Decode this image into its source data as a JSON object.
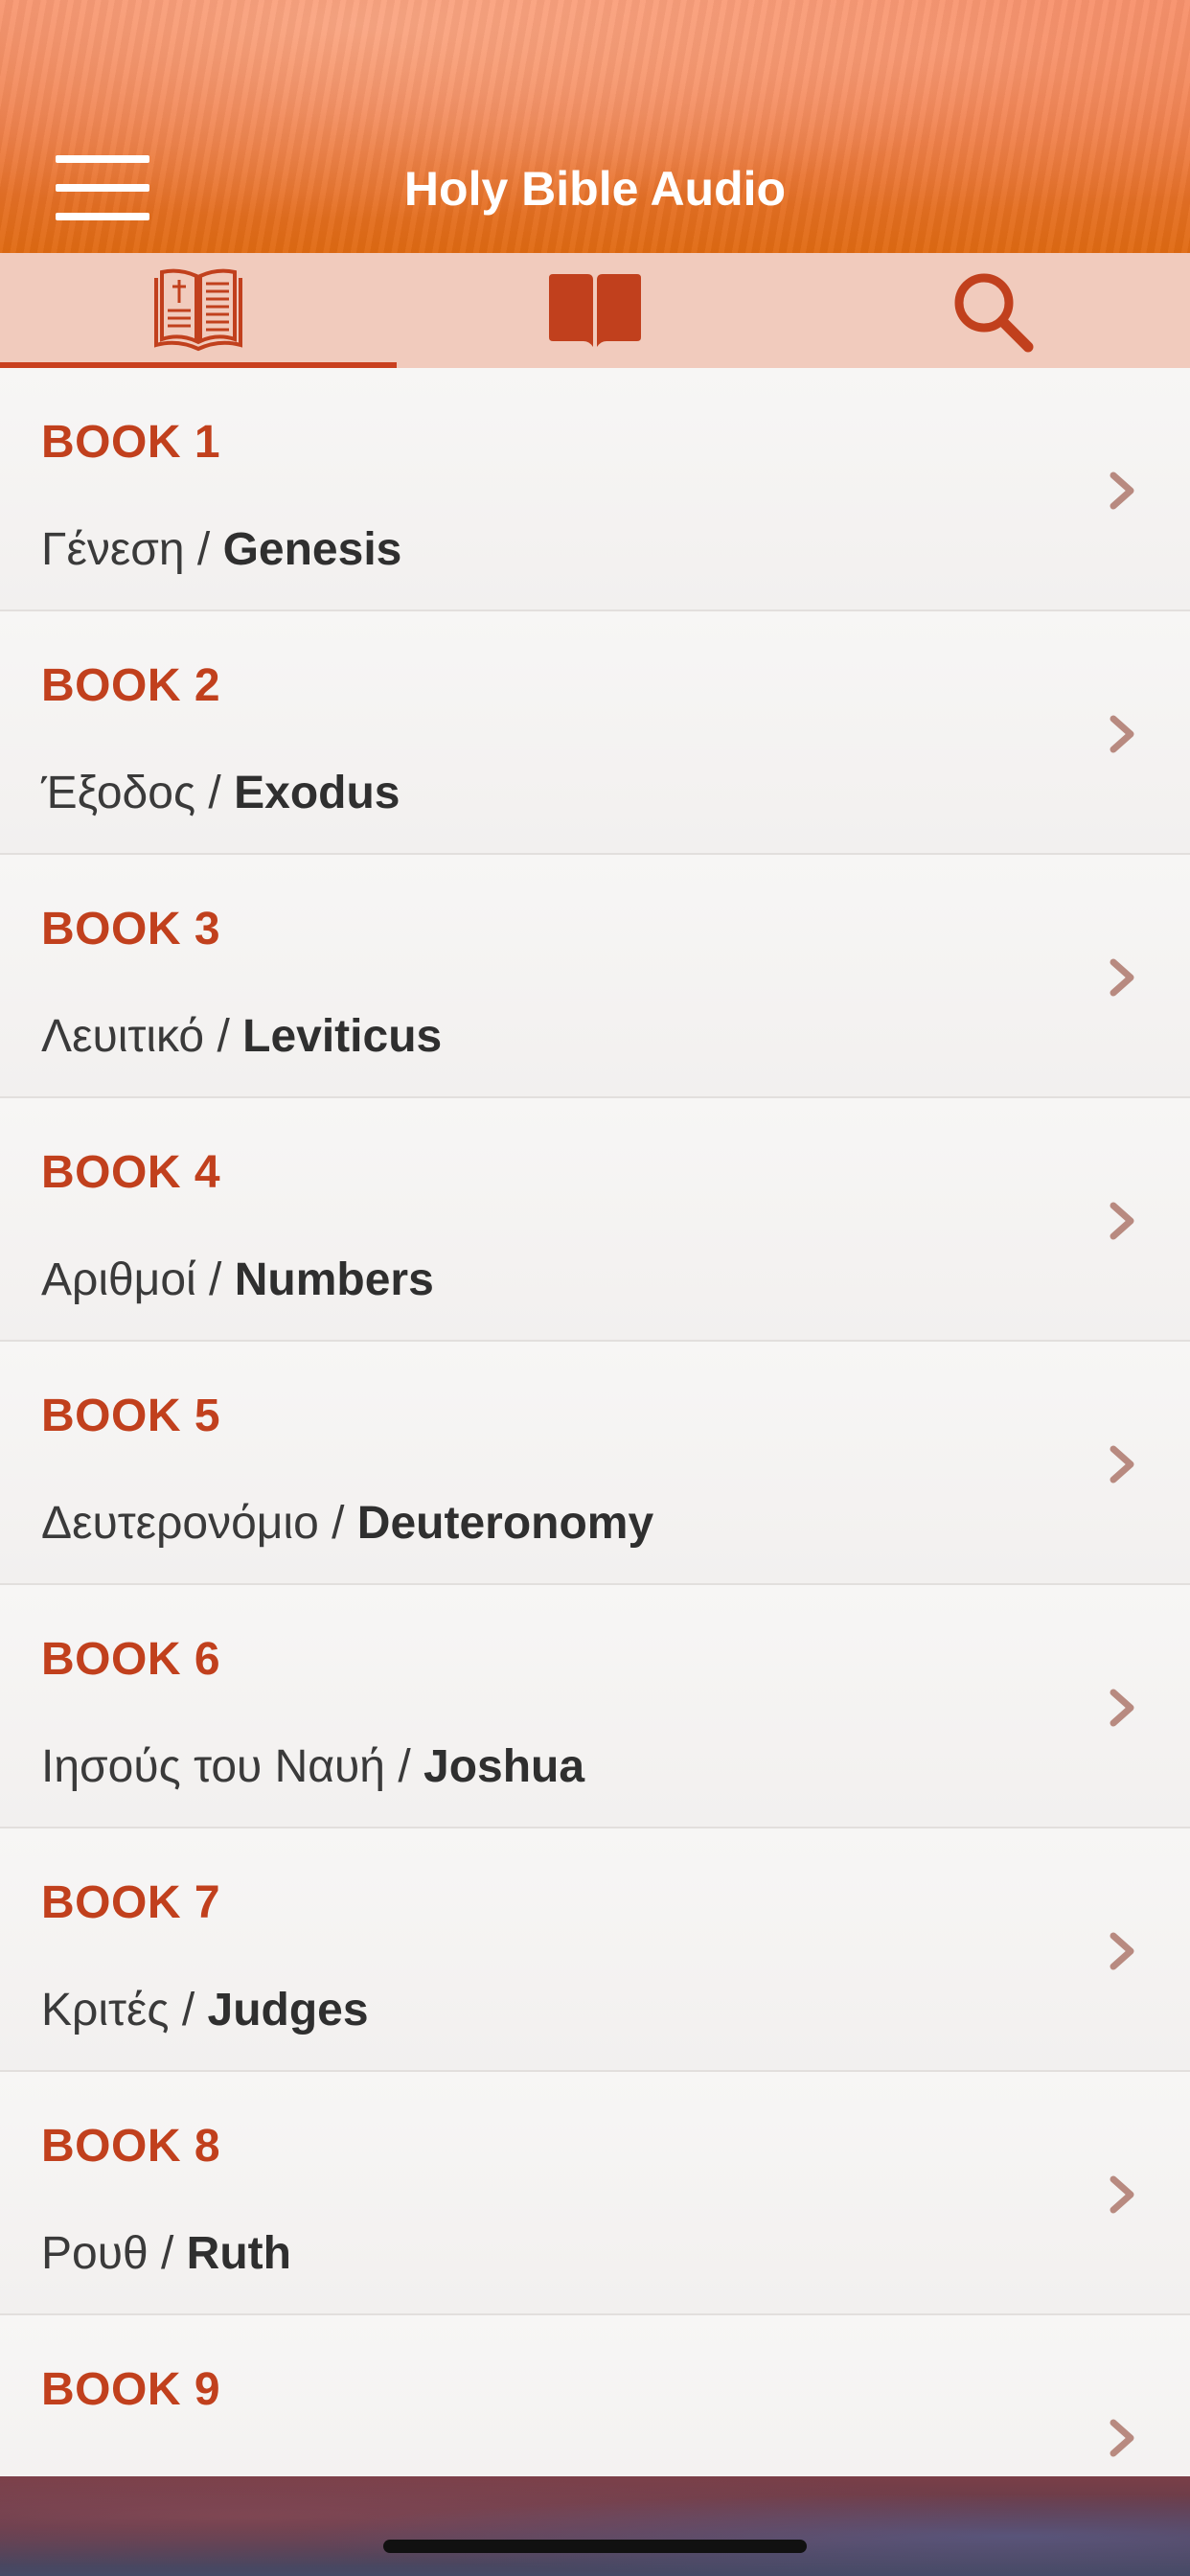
{
  "header": {
    "title": "Holy Bible Audio",
    "menu_icon": "hamburger-menu-icon",
    "background_color": "#e06a12"
  },
  "tabs": [
    {
      "icon": "bible-book-icon",
      "active": true
    },
    {
      "icon": "open-book-icon",
      "active": false
    },
    {
      "icon": "search-icon",
      "active": false
    }
  ],
  "colors": {
    "accent": "#c1401d",
    "tabbar": "#f1cbbd",
    "chevron": "#b88a80"
  },
  "books": [
    {
      "label": "BOOK 1",
      "greek": "Γένεση",
      "sep": " / ",
      "english": "Genesis"
    },
    {
      "label": "BOOK 2",
      "greek": "Έξοδος",
      "sep": " / ",
      "english": "Exodus"
    },
    {
      "label": "BOOK 3",
      "greek": "Λευιτικό",
      "sep": " / ",
      "english": "Leviticus"
    },
    {
      "label": "BOOK 4",
      "greek": "Αριθμοί",
      "sep": " / ",
      "english": "Numbers"
    },
    {
      "label": "BOOK 5",
      "greek": "Δευτερονόμιο",
      "sep": " / ",
      "english": "Deuteronomy"
    },
    {
      "label": "BOOK 6",
      "greek": "Ιησούς του Ναυή",
      "sep": " / ",
      "english": "Joshua"
    },
    {
      "label": "BOOK 7",
      "greek": "Κριτές",
      "sep": " / ",
      "english": "Judges"
    },
    {
      "label": "BOOK 8",
      "greek": "Ρουθ",
      "sep": " / ",
      "english": "Ruth"
    },
    {
      "label": "BOOK 9",
      "greek": "",
      "sep": "",
      "english": ""
    }
  ]
}
